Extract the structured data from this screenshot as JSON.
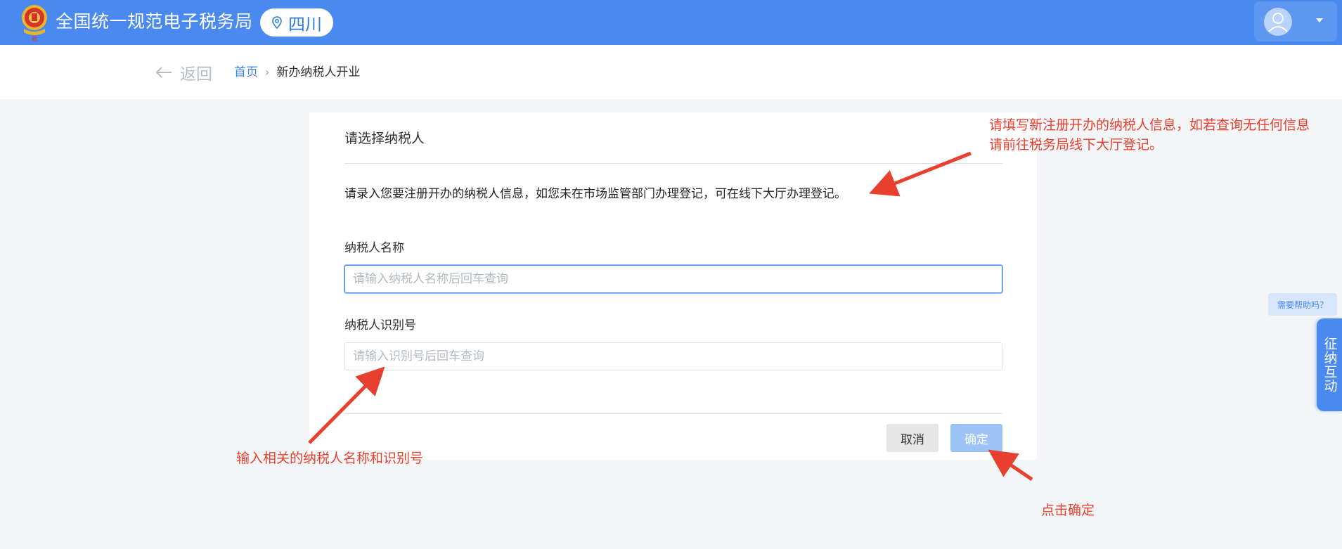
{
  "header": {
    "app_title": "全国统一规范电子税务局",
    "region": "四川",
    "emblem_icon": "tax-emblem-icon",
    "location_icon": "location-pin-icon",
    "user_icon": "user-avatar-icon",
    "dropdown_icon": "caret-down-icon",
    "brand_color": "#4a8af0"
  },
  "breadcrumb": {
    "back_label": "返回",
    "home_label": "首页",
    "separator": "›",
    "current_label": "新办纳税人开业"
  },
  "form": {
    "title": "请选择纳税人",
    "notice": "请录入您要注册开办的纳税人信息，如您未在市场监管部门办理登记，可在线下大厅办理登记。",
    "taxpayer_name": {
      "label": "纳税人名称",
      "placeholder": "请输入纳税人名称后回车查询",
      "value": ""
    },
    "taxpayer_id": {
      "label": "纳税人识别号",
      "placeholder": "请输入识别号后回车查询",
      "value": ""
    },
    "cancel_label": "取消",
    "confirm_label": "确定"
  },
  "side": {
    "help_label": "需要帮助吗？",
    "interact_label": "征纳互动"
  },
  "annotations": {
    "top_line1": "请填写新注册开办的纳税人信息，如若查询无任何信息",
    "top_line2": "请前往税务局线下大厅登记。",
    "left": "输入相关的纳税人名称和识别号",
    "right": "点击确定",
    "color": "#e8402e"
  }
}
